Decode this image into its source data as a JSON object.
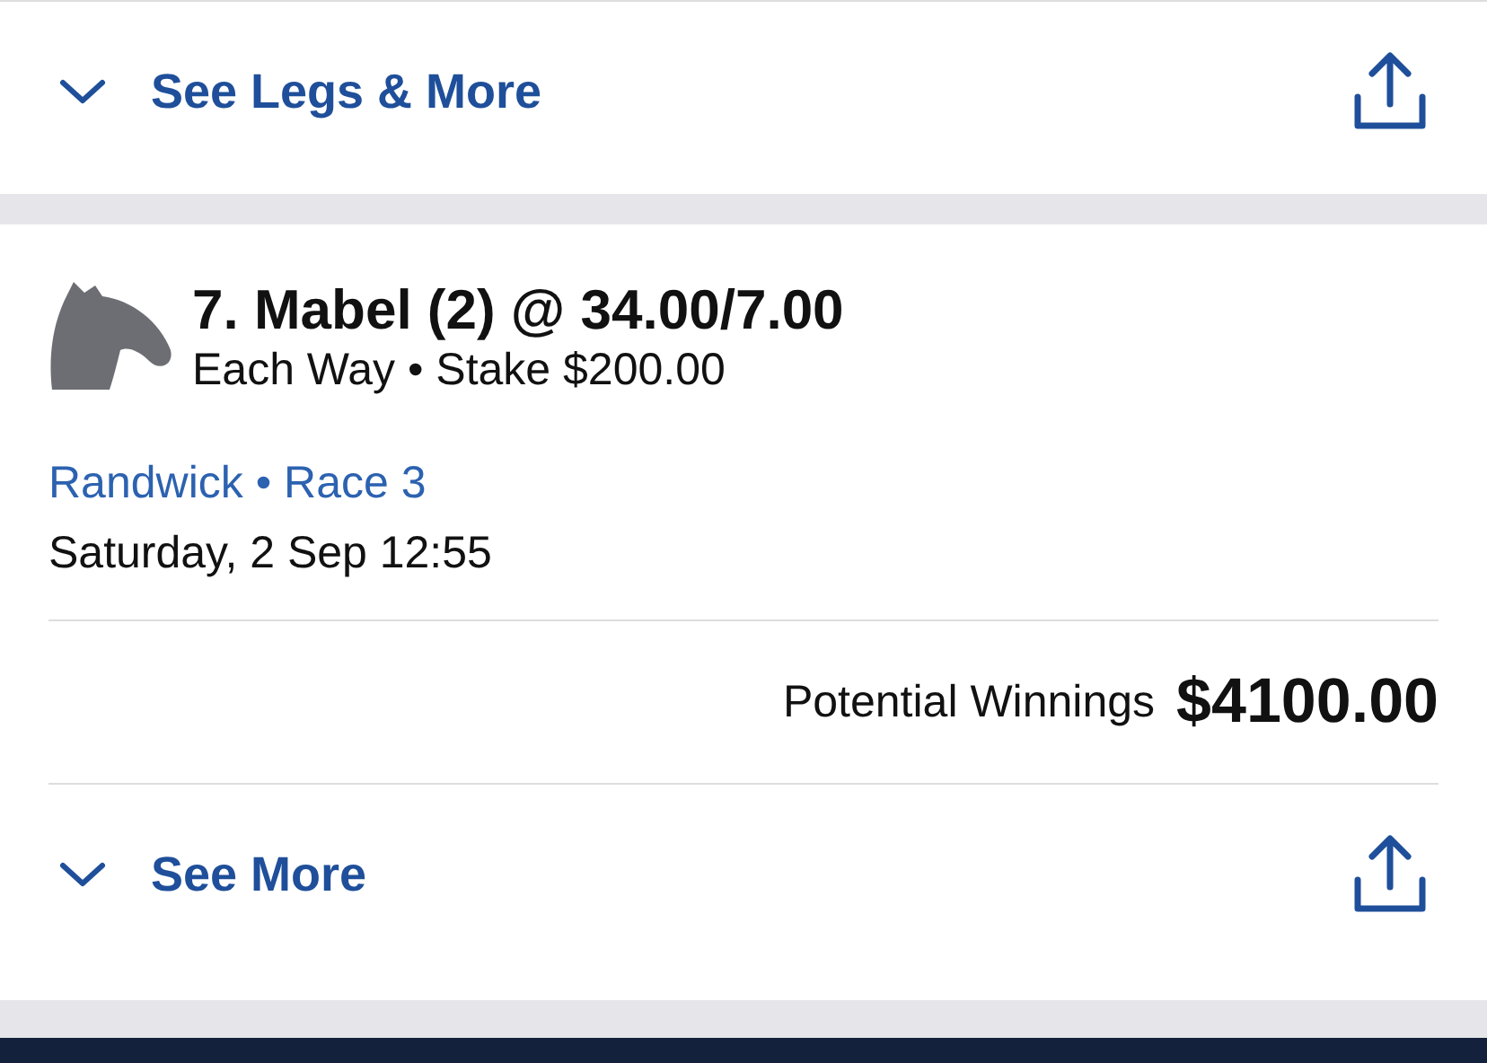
{
  "top_card": {
    "toggle_label": "See Legs & More"
  },
  "bet": {
    "title": "7. Mabel (2) @ 34.00/7.00",
    "subtitle": "Each Way • Stake $200.00",
    "meeting": "Randwick • Race 3",
    "start_time": "Saturday, 2 Sep 12:55",
    "winnings_label": "Potential Winnings",
    "winnings_value": "$4100.00",
    "toggle_label": "See More"
  }
}
